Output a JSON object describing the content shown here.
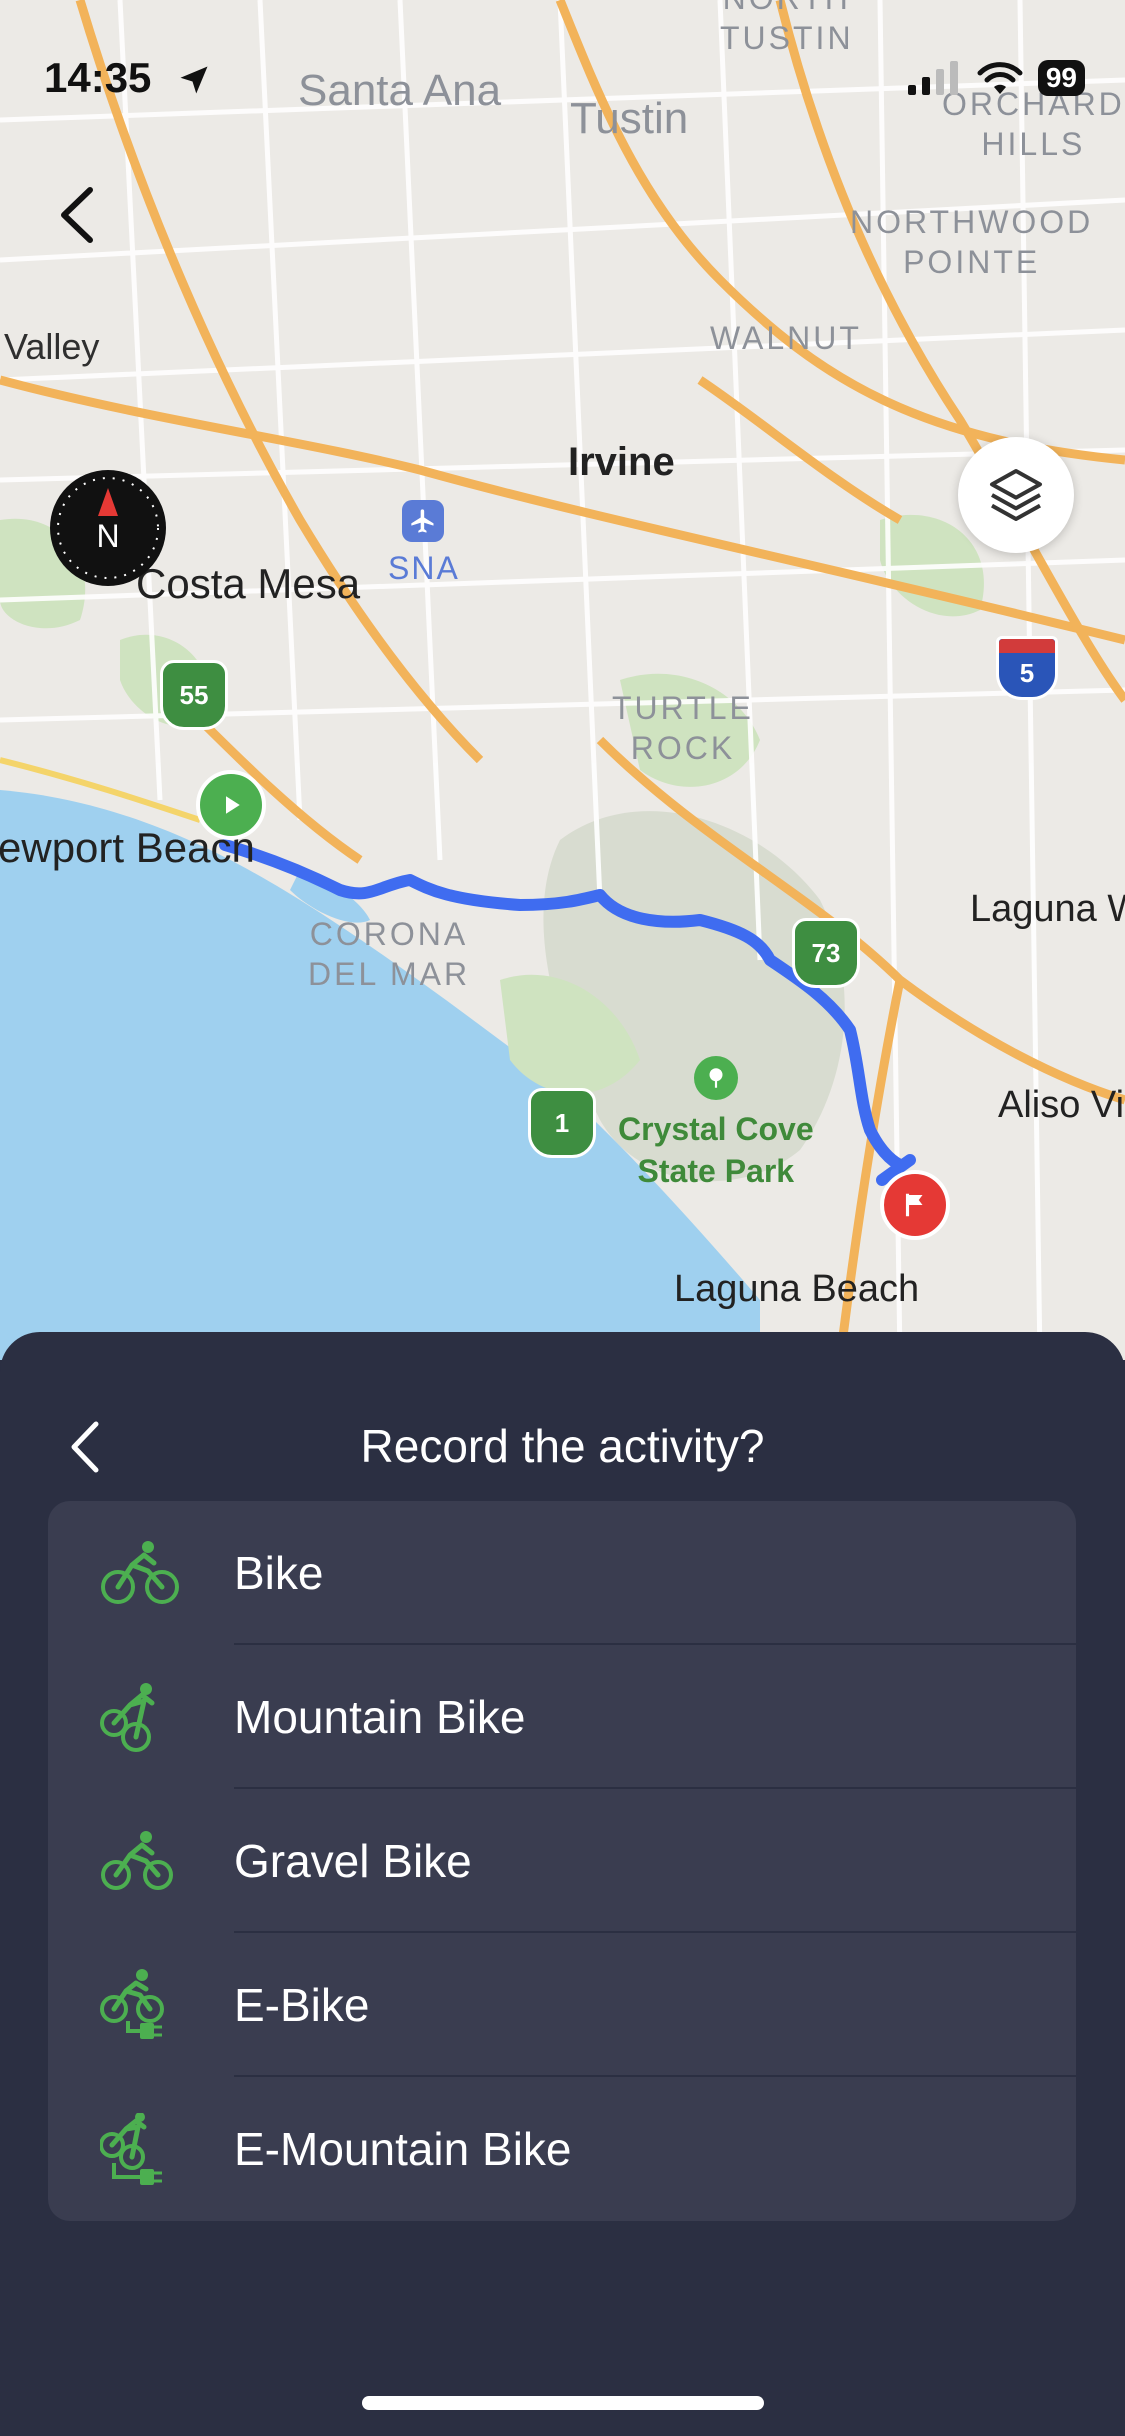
{
  "status_bar": {
    "time": "14:35",
    "battery": "99"
  },
  "map": {
    "labels": {
      "santa_ana": "Santa Ana",
      "tustin": "Tustin",
      "north_tustin": "NORTH\nTUSTIN",
      "orchard_hills": "ORCHARD\nHILLS",
      "northwood_pointe": "NORTHWOOD\nPOINTE",
      "walnut": "WALNUT",
      "valley": "Valley",
      "irvine": "Irvine",
      "costa_mesa": "Costa Mesa",
      "sna": "SNA",
      "turtle_rock": "TURTLE\nROCK",
      "newport_beach": "ewport Beach",
      "corona_del_mar": "CORONA\nDEL MAR",
      "laguna_woods": "Laguna W",
      "aliso_viejo": "Aliso Vi",
      "crystal_cove": "Crystal Cove\nState Park",
      "laguna_beach": "Laguna Beach",
      "route_55": "55",
      "route_73": "73",
      "route_1": "1",
      "route_5": "5"
    },
    "compass_label": "N"
  },
  "sheet": {
    "title": "Record the activity?",
    "options": [
      {
        "label": "Bike",
        "icon": "bike-icon"
      },
      {
        "label": "Mountain Bike",
        "icon": "mountain-bike-icon"
      },
      {
        "label": "Gravel Bike",
        "icon": "gravel-bike-icon"
      },
      {
        "label": "E-Bike",
        "icon": "e-bike-icon"
      },
      {
        "label": "E-Mountain Bike",
        "icon": "e-mountain-bike-icon"
      }
    ]
  },
  "colors": {
    "accent_green": "#4caf50",
    "route_blue": "#3f6cf0",
    "sheet_bg": "#2b2f42",
    "list_bg": "#3a3d50",
    "finish_red": "#e53935"
  }
}
